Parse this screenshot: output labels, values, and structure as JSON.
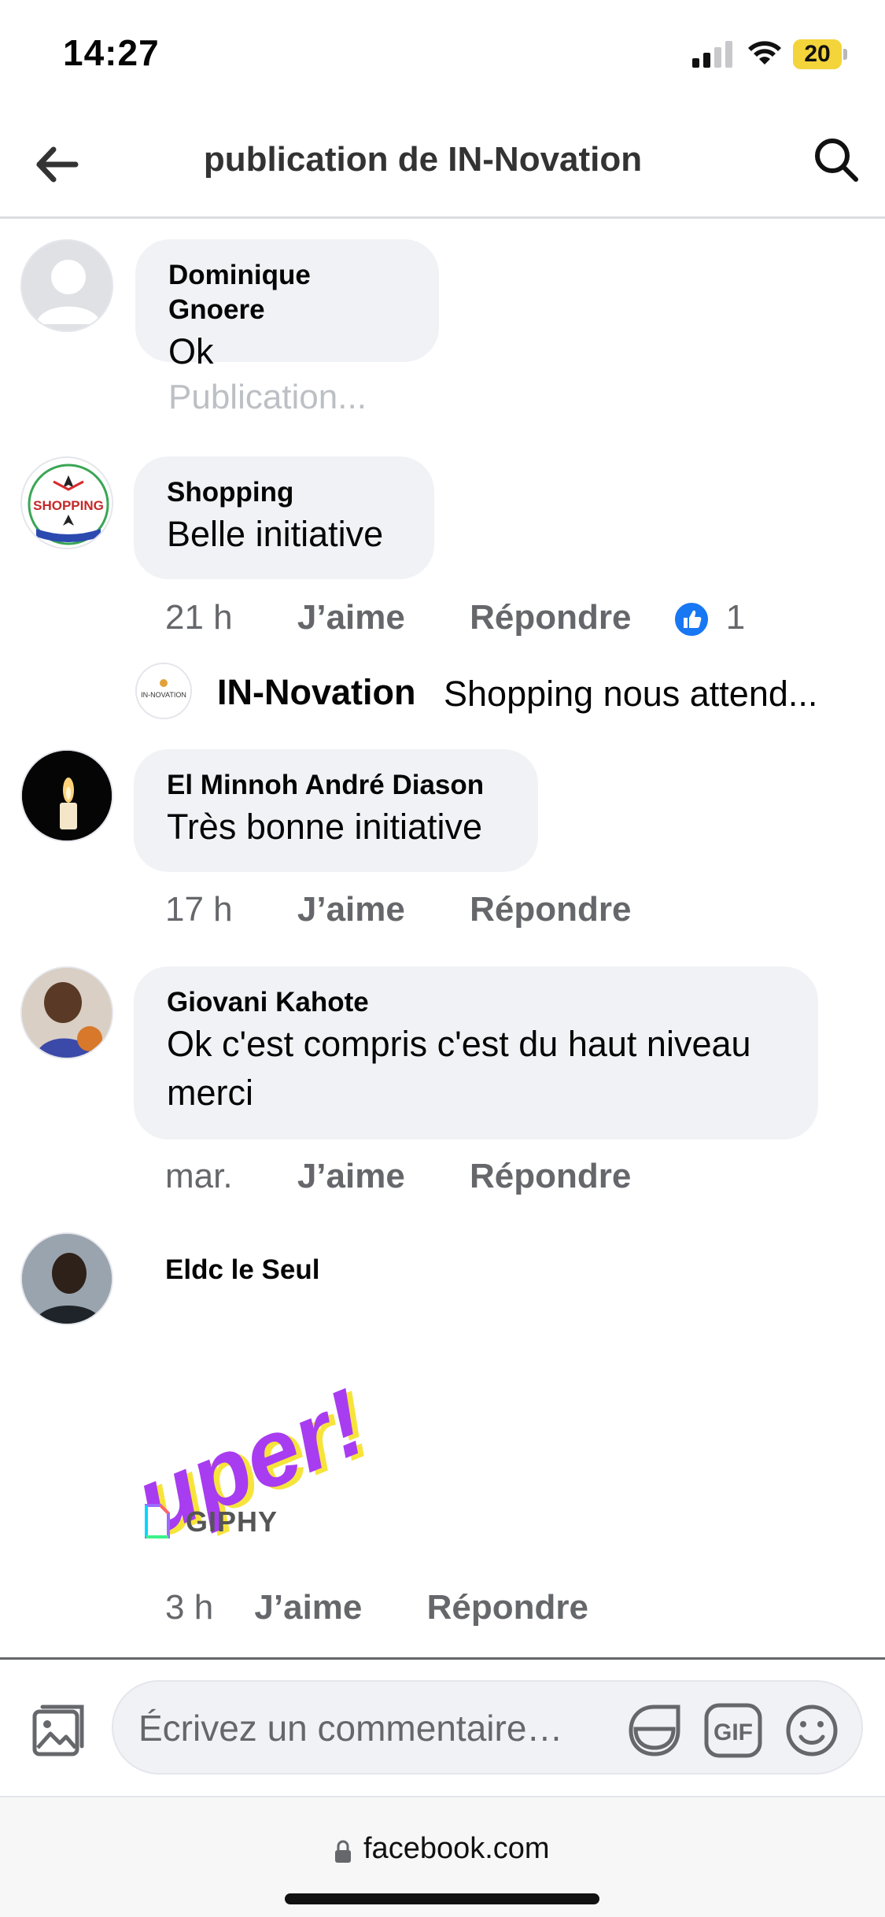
{
  "status_bar": {
    "time": "14:27",
    "battery": "20"
  },
  "header": {
    "title": "publication de IN-Novation"
  },
  "comments": [
    {
      "author": "Dominique Gnoere",
      "text": "Ok",
      "pending": "Publication..."
    },
    {
      "author": "Shopping",
      "text": "Belle initiative",
      "time": "21 h",
      "like": "J’aime",
      "reply": "Répondre",
      "reactions": "1",
      "avatar_text": "SHOPPING",
      "reply_preview": {
        "avatar_text": "IN-NOVATION",
        "author": "IN-Novation",
        "text": "Shopping nous attend..."
      }
    },
    {
      "author": "El Minnoh André Diason",
      "text": "Très bonne initiative",
      "time": "17 h",
      "like": "J’aime",
      "reply": "Répondre"
    },
    {
      "author": "Giovani Kahote",
      "text_line1": "Ok c'est compris c'est du haut niveau",
      "text_line2": "merci",
      "time": "mar.",
      "like": "J’aime",
      "reply": "Répondre"
    },
    {
      "author": "Eldc le Seul",
      "gif_text": "uper!",
      "gif_source": "GIPHY",
      "time": "3 h",
      "like": "J’aime",
      "reply": "Répondre"
    }
  ],
  "composer": {
    "placeholder": "Écrivez un commentaire…",
    "gif_label": "GIF"
  },
  "browser": {
    "url": "facebook.com"
  },
  "colors": {
    "accent": "#1877f2",
    "bubble": "#f0f2f5",
    "meta": "#65676b",
    "gif": "#a83cf0"
  }
}
